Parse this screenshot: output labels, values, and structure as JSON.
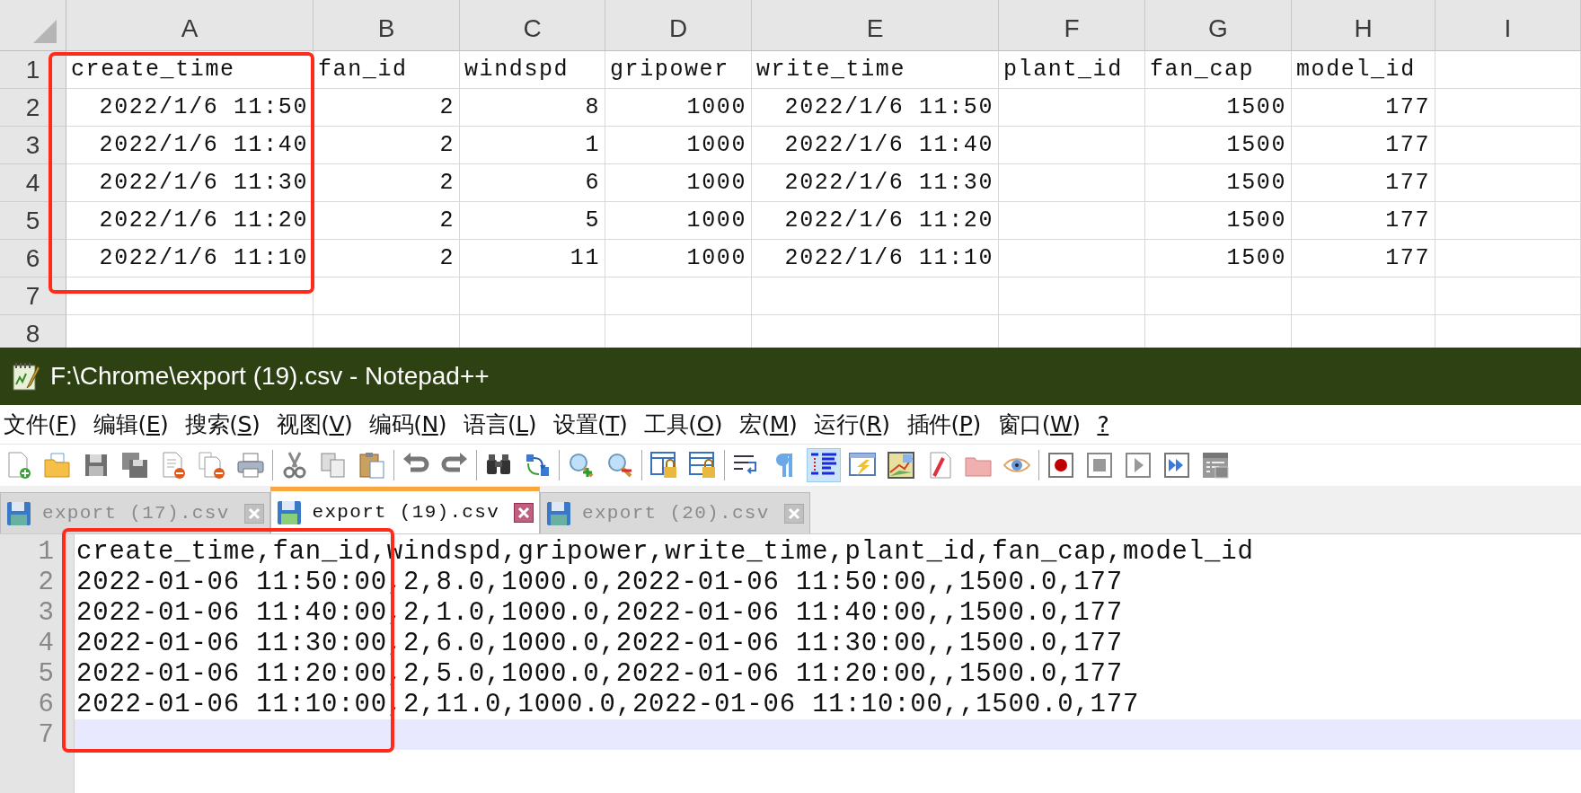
{
  "spreadsheet": {
    "columns": [
      "A",
      "B",
      "C",
      "D",
      "E",
      "F",
      "G",
      "H",
      "I"
    ],
    "rows": [
      {
        "number": "1",
        "kind": "header",
        "cells": [
          "create_time",
          "fan_id",
          "windspd",
          "gripower",
          "write_time",
          "plant_id",
          "fan_cap",
          "model_id"
        ]
      },
      {
        "number": "2",
        "kind": "data",
        "cells": [
          "2022/1/6 11:50",
          "2",
          "8",
          "1000",
          "2022/1/6 11:50",
          null,
          "1500",
          "177"
        ]
      },
      {
        "number": "3",
        "kind": "data",
        "cells": [
          "2022/1/6 11:40",
          "2",
          "1",
          "1000",
          "2022/1/6 11:40",
          null,
          "1500",
          "177"
        ]
      },
      {
        "number": "4",
        "kind": "data",
        "cells": [
          "2022/1/6 11:30",
          "2",
          "6",
          "1000",
          "2022/1/6 11:30",
          null,
          "1500",
          "177"
        ]
      },
      {
        "number": "5",
        "kind": "data",
        "cells": [
          "2022/1/6 11:20",
          "2",
          "5",
          "1000",
          "2022/1/6 11:20",
          null,
          "1500",
          "177"
        ]
      },
      {
        "number": "6",
        "kind": "data",
        "cells": [
          "2022/1/6 11:10",
          "2",
          "11",
          "1000",
          "2022/1/6 11:10",
          null,
          "1500",
          "177"
        ]
      },
      {
        "number": "7",
        "kind": "data",
        "cells": []
      },
      {
        "number": "8",
        "kind": "data",
        "cells": []
      }
    ]
  },
  "notepad": {
    "title": "F:\\Chrome\\export (19).csv - Notepad++",
    "menu": [
      {
        "before": "文件(",
        "key": "F",
        "after": ")"
      },
      {
        "before": "编辑(",
        "key": "E",
        "after": ")"
      },
      {
        "before": "搜索(",
        "key": "S",
        "after": ")"
      },
      {
        "before": "视图(",
        "key": "V",
        "after": ")"
      },
      {
        "before": "编码(",
        "key": "N",
        "after": ")"
      },
      {
        "before": "语言(",
        "key": "L",
        "after": ")"
      },
      {
        "before": "设置(",
        "key": "T",
        "after": ")"
      },
      {
        "before": "工具(",
        "key": "O",
        "after": ")"
      },
      {
        "before": "宏(",
        "key": "M",
        "after": ")"
      },
      {
        "before": "运行(",
        "key": "R",
        "after": ")"
      },
      {
        "before": "插件(",
        "key": "P",
        "after": ")"
      },
      {
        "before": "窗口(",
        "key": "W",
        "after": ")"
      },
      {
        "key": "?"
      }
    ],
    "toolbar": [
      {
        "buttons": [
          {
            "kind": "new",
            "selected": false
          },
          {
            "kind": "open",
            "selected": false
          },
          {
            "kind": "save",
            "selected": false
          },
          {
            "kind": "saveall",
            "selected": false
          },
          {
            "kind": "close",
            "selected": false
          },
          {
            "kind": "closeall",
            "selected": false
          },
          {
            "kind": "print",
            "selected": false
          }
        ]
      },
      {
        "buttons": [
          {
            "kind": "cut",
            "selected": false
          },
          {
            "kind": "copy",
            "selected": false
          },
          {
            "kind": "paste",
            "selected": false
          }
        ]
      },
      {
        "buttons": [
          {
            "kind": "undo",
            "selected": false
          },
          {
            "kind": "redo",
            "selected": false
          }
        ]
      },
      {
        "buttons": [
          {
            "kind": "find",
            "selected": false
          },
          {
            "kind": "replace",
            "selected": false
          }
        ]
      },
      {
        "buttons": [
          {
            "kind": "zoomin",
            "selected": false
          },
          {
            "kind": "zoomout",
            "selected": false
          }
        ]
      },
      {
        "buttons": [
          {
            "kind": "syncv",
            "selected": false
          },
          {
            "kind": "synch",
            "selected": false
          }
        ]
      },
      {
        "buttons": [
          {
            "kind": "wrap",
            "selected": false
          },
          {
            "kind": "pilcrow",
            "selected": false
          },
          {
            "kind": "indent",
            "selected": true
          },
          {
            "kind": "lightning",
            "selected": false
          },
          {
            "kind": "map",
            "selected": false
          },
          {
            "kind": "funclist",
            "selected": false
          },
          {
            "kind": "folder",
            "selected": false
          },
          {
            "kind": "eye",
            "selected": false
          }
        ]
      },
      {
        "buttons": [
          {
            "kind": "record",
            "selected": false
          },
          {
            "kind": "stop",
            "selected": false
          },
          {
            "kind": "play",
            "selected": false
          },
          {
            "kind": "playmulti",
            "selected": false
          },
          {
            "kind": "savemacro",
            "selected": false
          }
        ]
      }
    ],
    "tabs": [
      {
        "label": "export (17).csv",
        "selected": false
      },
      {
        "label": "export (19).csv",
        "selected": true
      },
      {
        "label": "export (20).csv",
        "selected": false
      }
    ],
    "editor": {
      "lines": [
        {
          "number": "1",
          "text": "create_time,fan_id,windspd,gripower,write_time,plant_id,fan_cap,model_id",
          "current": false
        },
        {
          "number": "2",
          "text": "2022-01-06 11:50:00,2,8.0,1000.0,2022-01-06 11:50:00,,1500.0,177",
          "current": false
        },
        {
          "number": "3",
          "text": "2022-01-06 11:40:00,2,1.0,1000.0,2022-01-06 11:40:00,,1500.0,177",
          "current": false
        },
        {
          "number": "4",
          "text": "2022-01-06 11:30:00,2,6.0,1000.0,2022-01-06 11:30:00,,1500.0,177",
          "current": false
        },
        {
          "number": "5",
          "text": "2022-01-06 11:20:00,2,5.0,1000.0,2022-01-06 11:20:00,,1500.0,177",
          "current": false
        },
        {
          "number": "6",
          "text": "2022-01-06 11:10:00,2,11.0,1000.0,2022-01-06 11:10:00,,1500.0,177",
          "current": false
        },
        {
          "number": "7",
          "current": true
        }
      ]
    }
  }
}
